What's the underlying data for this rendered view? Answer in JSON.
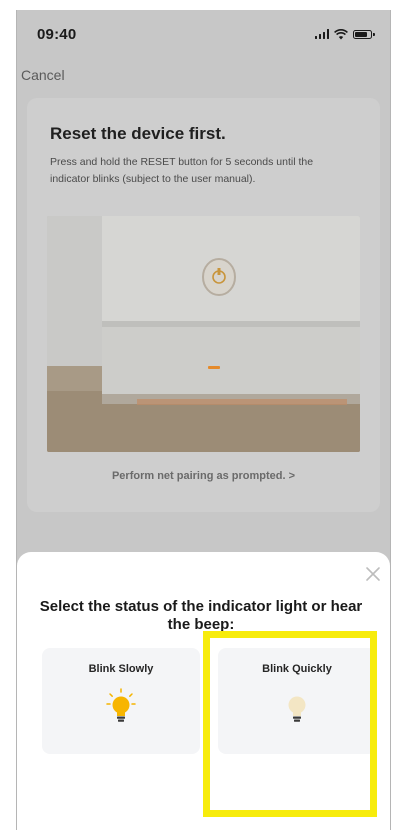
{
  "status_bar": {
    "time": "09:40"
  },
  "navigation": {
    "cancel_label": "Cancel"
  },
  "reset_card": {
    "title": "Reset the device first.",
    "description": "Press and hold the RESET button for 5 seconds until the indicator blinks (subject to the user manual).",
    "pairing_link": "Perform net pairing as prompted. >"
  },
  "sheet": {
    "title": "Select the status of the indicator light or hear the beep:",
    "options": [
      {
        "label": "Blink Slowly",
        "icon": "bulb-glowing-icon"
      },
      {
        "label": "Blink Quickly",
        "icon": "bulb-dim-icon"
      }
    ]
  },
  "colors": {
    "overlay": "#c7c7c7",
    "card": "#cecece",
    "option_bg": "#f4f5f7",
    "highlight": "#f7ec0c",
    "bulb_yellow": "#f5b400"
  }
}
